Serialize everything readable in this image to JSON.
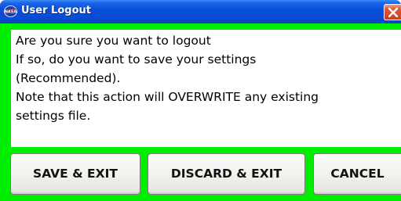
{
  "window": {
    "title": "User Logout",
    "icon": "nasa-meatball-logo",
    "close_icon": "close-icon",
    "frame_color": "#00ee00",
    "titlebar_color": "#0a4fd9"
  },
  "message": {
    "lines": [
      "Are you sure you want to logout",
      "If so, do you want to save your settings",
      "(Recommended).",
      "Note that this action will OVERWRITE any existing",
      "settings file."
    ]
  },
  "buttons": {
    "save_exit": "SAVE & EXIT",
    "discard_exit": "DISCARD & EXIT",
    "cancel": "CANCEL"
  }
}
